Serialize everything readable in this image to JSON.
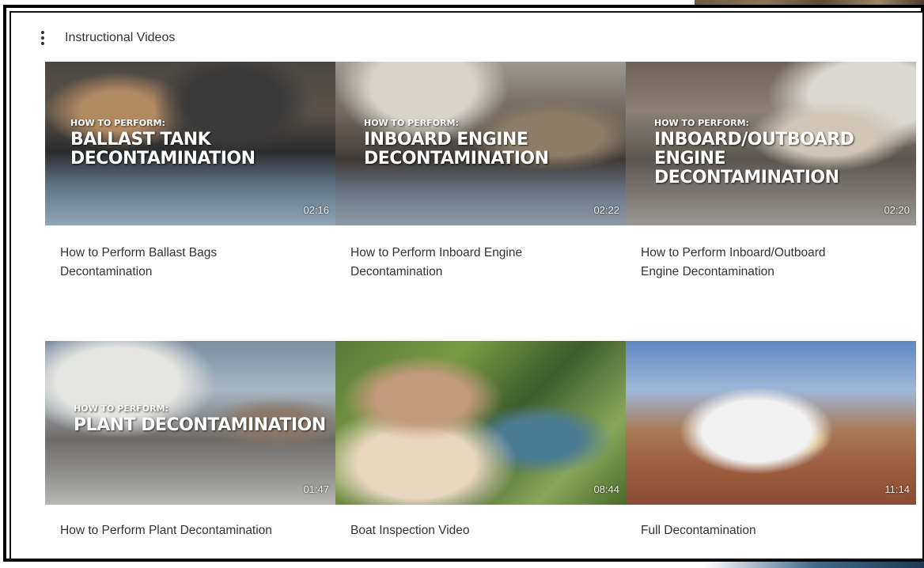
{
  "header": {
    "menu_icon": "kebab-menu-icon",
    "title": "Instructional Videos"
  },
  "videos": [
    {
      "overlay_small": "HOW TO PERFORM:",
      "overlay_big_1": "BALLAST TANK",
      "overlay_big_2": "DECONTAMINATION",
      "duration": "02:16",
      "caption_line1": "How to Perform Ballast Bags",
      "caption_line2": "Decontamination"
    },
    {
      "overlay_small": "HOW TO PERFORM:",
      "overlay_big_1": "INBOARD ENGINE",
      "overlay_big_2": "DECONTAMINATION",
      "duration": "02:22",
      "caption_line1": "How to Perform Inboard Engine",
      "caption_line2": "Decontamination"
    },
    {
      "overlay_small": "HOW TO PERFORM:",
      "overlay_big_1": "INBOARD/OUTBOARD ENGINE",
      "overlay_big_2": "DECONTAMINATION",
      "duration": "02:20",
      "caption_line1": "How to Perform Inboard/Outboard",
      "caption_line2": "Engine Decontamination"
    },
    {
      "overlay_small": "HOW TO PERFORM:",
      "overlay_big_1": "PLANT DECONTAMINATION",
      "overlay_big_2": "",
      "duration": "01:47",
      "caption_line1": "How to Perform Plant Decontamination",
      "caption_line2": ""
    },
    {
      "overlay_small": "",
      "overlay_big_1": "",
      "overlay_big_2": "",
      "duration": "08:44",
      "caption_line1": "Boat Inspection Video",
      "caption_line2": ""
    },
    {
      "overlay_small": "",
      "overlay_big_1": "",
      "overlay_big_2": "",
      "duration": "11:14",
      "caption_line1": "Full Decontamination",
      "caption_line2": ""
    }
  ]
}
